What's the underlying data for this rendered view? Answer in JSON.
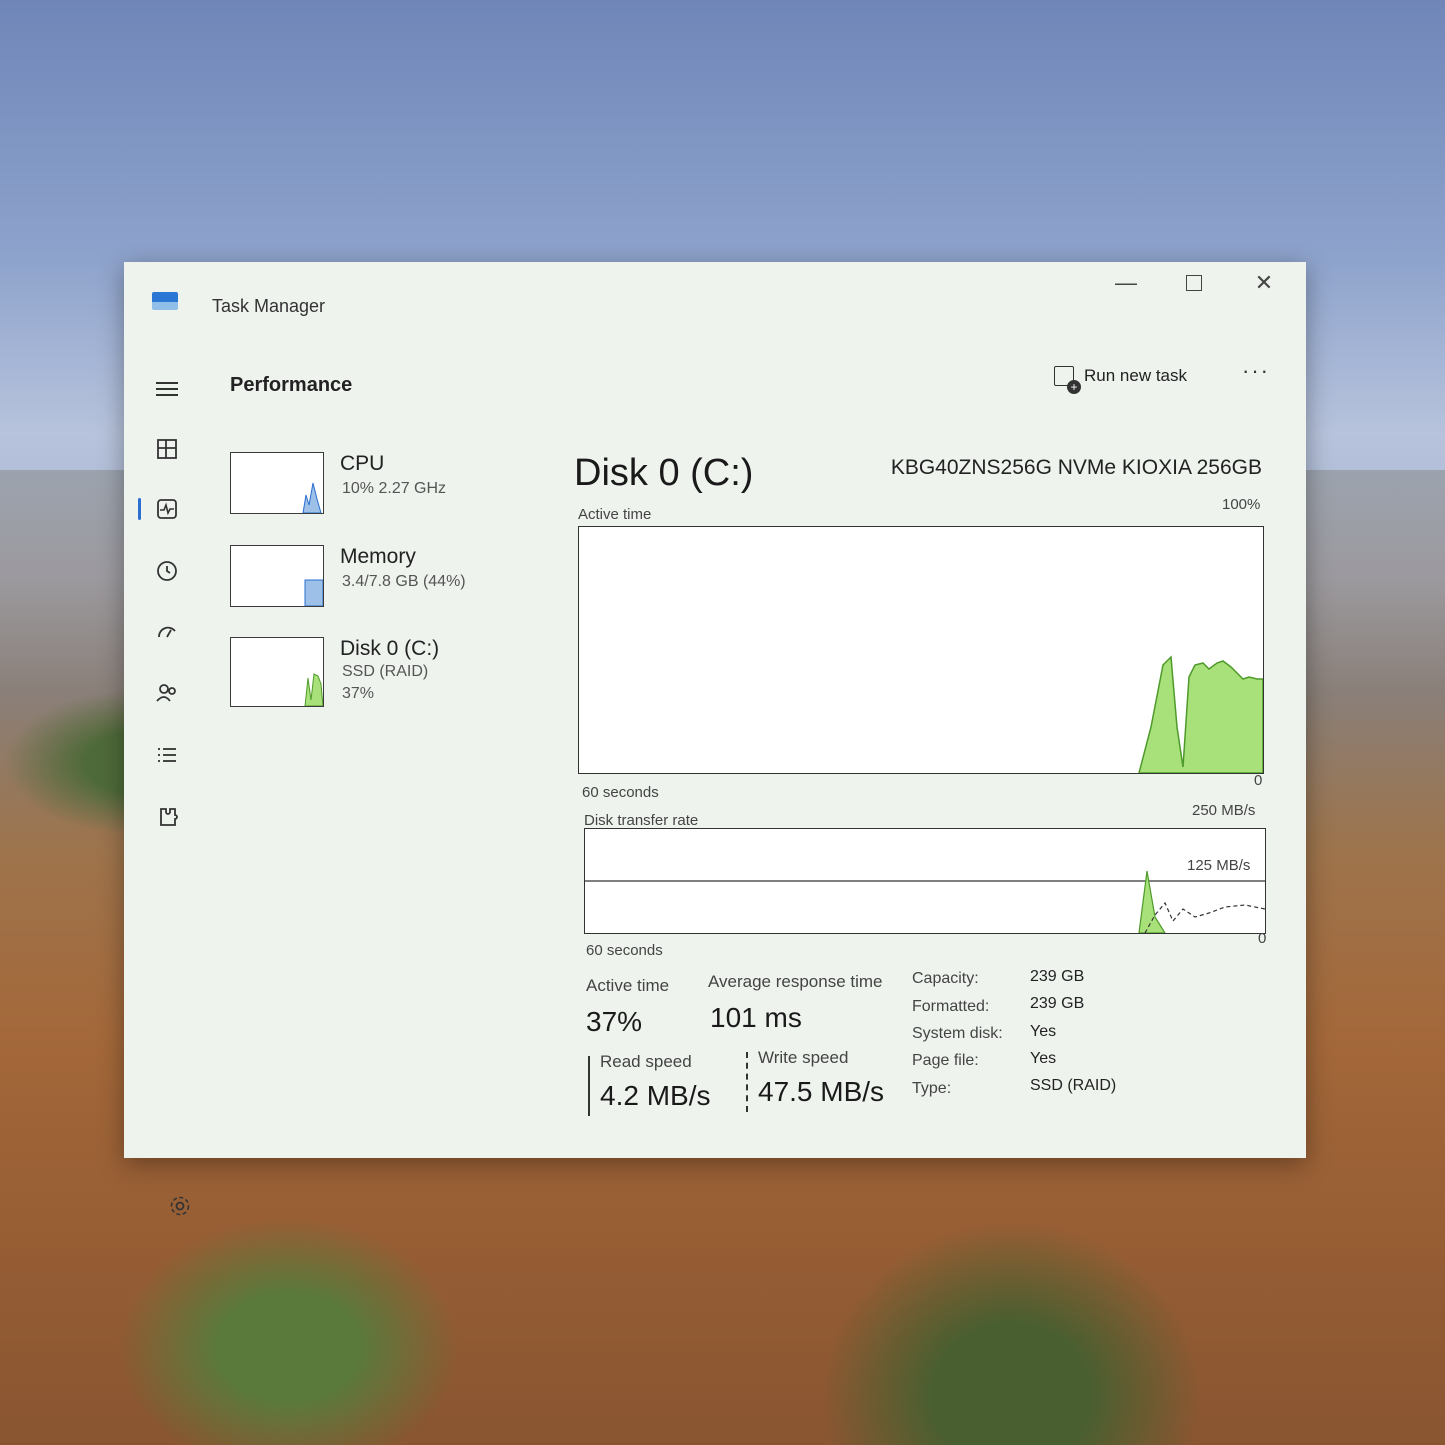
{
  "window": {
    "title": "Task Manager"
  },
  "header": {
    "page_title": "Performance",
    "run_new_task": "Run new task",
    "more": "···"
  },
  "nav_icons": [
    "hamburger-icon",
    "processes-icon",
    "performance-icon",
    "app-history-icon",
    "startup-apps-icon",
    "users-icon",
    "details-icon",
    "services-icon",
    "settings-icon"
  ],
  "sidebar": {
    "cpu": {
      "name": "CPU",
      "sub": "10% 2.27 GHz"
    },
    "memory": {
      "name": "Memory",
      "sub": "3.4/7.8 GB (44%)"
    },
    "disk": {
      "name": "Disk 0 (C:)",
      "sub1": "SSD (RAID)",
      "sub2": "37%"
    }
  },
  "main": {
    "title": "Disk 0 (C:)",
    "model": "KBG40ZNS256G NVMe KIOXIA 256GB",
    "active_time_graph": {
      "label": "Active time",
      "max": "100%",
      "min": "0",
      "duration": "60 seconds"
    },
    "transfer_graph": {
      "label": "Disk transfer rate",
      "max": "250 MB/s",
      "mid": "125 MB/s",
      "min": "0",
      "duration": "60 seconds"
    },
    "stats": {
      "active_time_label": "Active time",
      "active_time_value": "37%",
      "avg_response_label": "Average response time",
      "avg_response_value": "101 ms",
      "read_label": "Read speed",
      "read_value": "4.2 MB/s",
      "write_label": "Write speed",
      "write_value": "47.5 MB/s"
    },
    "properties": [
      {
        "k": "Capacity:",
        "v": "239 GB"
      },
      {
        "k": "Formatted:",
        "v": "239 GB"
      },
      {
        "k": "System disk:",
        "v": "Yes"
      },
      {
        "k": "Page file:",
        "v": "Yes"
      },
      {
        "k": "Type:",
        "v": "SSD (RAID)"
      }
    ]
  },
  "colors": {
    "accent": "#2b6fd0",
    "disk_fill": "#a8e07a",
    "disk_line": "#4e9a2a",
    "memory_fill": "#9cc0e8"
  }
}
